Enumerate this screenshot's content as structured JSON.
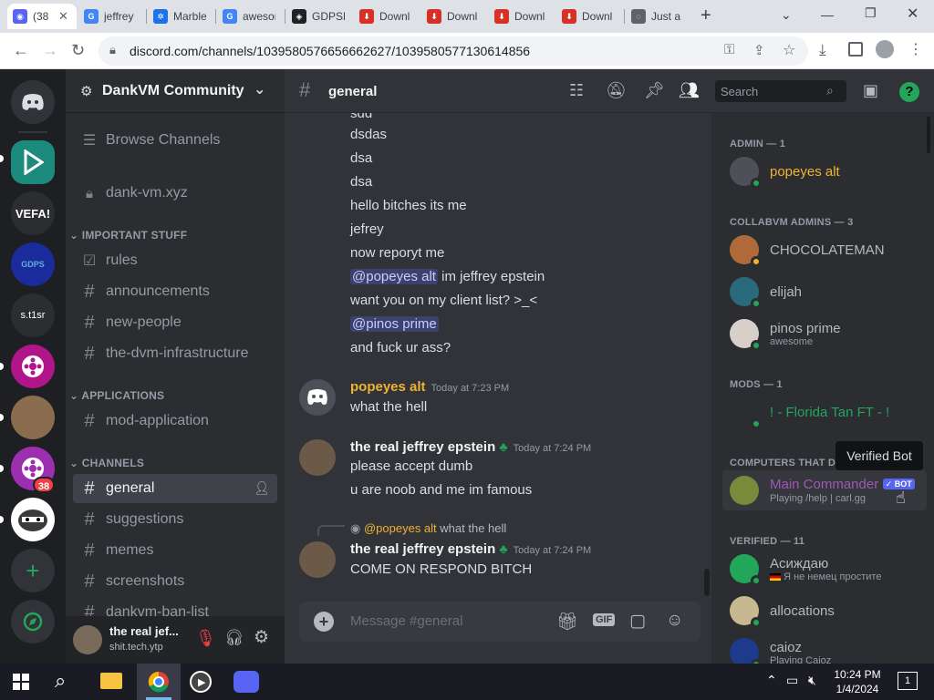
{
  "browser": {
    "tabs": [
      {
        "label": "(38",
        "color": "#5865f2",
        "active": true
      },
      {
        "label": "jeffrey",
        "color": "#4285f4"
      },
      {
        "label": "Marble",
        "color": "#1a73e8"
      },
      {
        "label": "awesome",
        "color": "#4285f4"
      },
      {
        "label": "GDPSF",
        "color": "#202124"
      },
      {
        "label": "Downl",
        "color": "#d93025"
      },
      {
        "label": "Downl",
        "color": "#d93025"
      },
      {
        "label": "Downl",
        "color": "#d93025"
      },
      {
        "label": "Downl",
        "color": "#d93025"
      },
      {
        "label": "Just a",
        "color": "#5f6368"
      }
    ],
    "url": "discord.com/channels/1039580576656662627/1039580577130614856"
  },
  "server": {
    "name": "DankVM Community",
    "browse": "Browse Channels",
    "locked_channel": "dank-vm.xyz",
    "categories": [
      {
        "name": "IMPORTANT STUFF",
        "channels": [
          "rules",
          "announcements",
          "new-people",
          "the-dvm-infrastructure"
        ]
      },
      {
        "name": "APPLICATIONS",
        "channels": [
          "mod-application"
        ]
      },
      {
        "name": "CHANNELS",
        "channels": [
          "general",
          "suggestions",
          "memes",
          "screenshots",
          "dankvm-ban-list"
        ]
      }
    ],
    "guild_labels": {
      "vefa": "VEFA!",
      "st1sr": "s.t1sr",
      "badge": "38"
    }
  },
  "user_panel": {
    "name": "the real jef...",
    "status": "shit.tech.ytp"
  },
  "chat": {
    "channel": "general",
    "search_placeholder": "Search",
    "composer_placeholder": "Message #general",
    "lines_top": [
      "sdd",
      "dsdas",
      "dsa",
      "dsa",
      "hello bitches its me",
      "jefrey",
      "now reporyt me"
    ],
    "line_mention1": {
      "mention": "@popeyes alt",
      "text": " im jeffrey epstein"
    },
    "line_client": "want you on my client list? >_<",
    "line_mention2": "@pinos prime",
    "line_last": "and fuck ur ass?",
    "messages": [
      {
        "author": "popeyes alt",
        "time": "Today at 7:23 PM",
        "color": "#f0b232",
        "lines": [
          "what the hell"
        ]
      },
      {
        "author": "the real jeffrey epstein",
        "time": "Today at 7:24 PM",
        "color": "#f2f3f5",
        "lines": [
          "please accept dumb",
          "u are noob and me im famous"
        ]
      },
      {
        "author": "the real jeffrey epstein",
        "time": "Today at 7:24 PM",
        "color": "#f2f3f5",
        "reply_mention": "@popeyes alt",
        "reply_text": "what the hell",
        "lines": [
          "COME ON RESPOND BITCH"
        ]
      }
    ]
  },
  "members": {
    "admin": {
      "header": "ADMIN — 1",
      "members": [
        {
          "name": "popeyes alt",
          "color": "#f0b232"
        }
      ]
    },
    "collab": {
      "header": "COLLABVM ADMINS — 3",
      "members": [
        {
          "name": "CHOCOLATEMAN",
          "color": "#b5bac1"
        },
        {
          "name": "elijah",
          "color": "#b5bac1"
        },
        {
          "name": "pinos prime",
          "color": "#b5bac1",
          "sub": "awesome"
        }
      ]
    },
    "mods": {
      "header": "MODS — 1",
      "members": [
        {
          "name": "! - Florida Tan FT - !",
          "color": "#23a55a"
        }
      ]
    },
    "computers": {
      "header": "COMPUTERS THAT D",
      "members": [
        {
          "name": "Main Commander",
          "color": "#9b59b6",
          "sub": "Playing /help | carl.gg",
          "badge": "✓ BOT"
        }
      ]
    },
    "verified": {
      "header": "VERIFIED — 11",
      "members": [
        {
          "name": "Асиждаю",
          "color": "#b5bac1",
          "sub": "Я не немец простите"
        },
        {
          "name": "allocations",
          "color": "#b5bac1"
        },
        {
          "name": "caioz",
          "color": "#b5bac1",
          "sub": "Playing Caioz"
        }
      ]
    },
    "tooltip": "Verified Bot"
  },
  "taskbar": {
    "time": "10:24 PM",
    "date": "1/4/2024",
    "notif": "1"
  }
}
